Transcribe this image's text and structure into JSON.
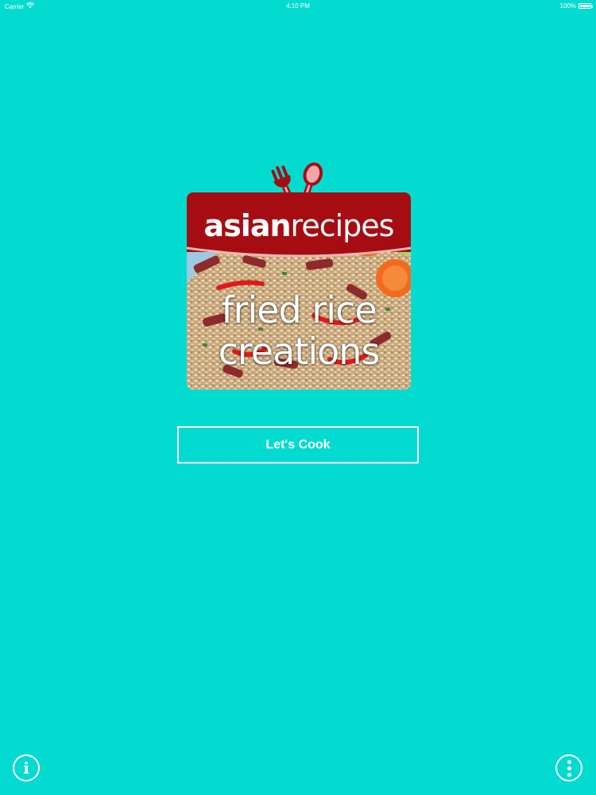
{
  "status_bar": {
    "carrier": "Carrier",
    "wifi_icon": "wifi-icon",
    "time": "4:10 PM",
    "battery_percent": "100%",
    "battery_icon": "battery-icon",
    "battery_level": 1.0
  },
  "logo": {
    "brand_bold": "asian",
    "brand_light": "recipes",
    "title_line1": "fried rice",
    "title_line2": "creations",
    "utensils_icon": "fork-spoon-icon",
    "header_color": "#a50d13"
  },
  "actions": {
    "cook_label": "Let's Cook"
  },
  "footer": {
    "info_icon": "info-icon",
    "info_glyph": "i",
    "more_icon": "more-vertical-icon"
  },
  "colors": {
    "background": "#03dbd0",
    "foreground": "#ffffff"
  }
}
